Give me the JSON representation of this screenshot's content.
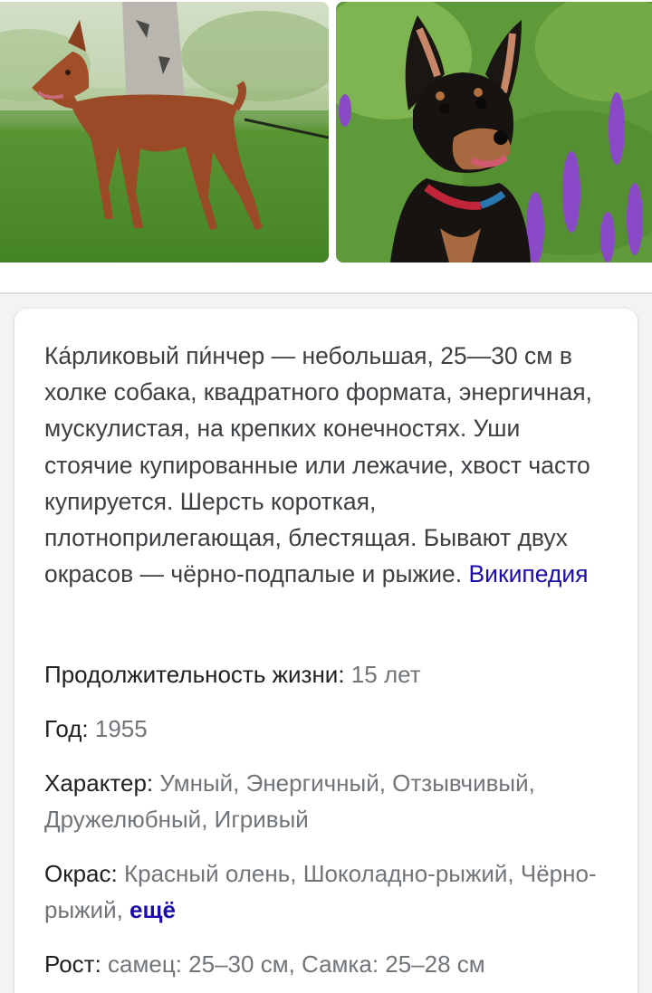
{
  "gallery": {
    "images": [
      {
        "subject": "red miniature pinscher standing on grass on a leash"
      },
      {
        "subject": "black and tan miniature pinscher among purple flowers"
      }
    ]
  },
  "card": {
    "description": "Ка́рликовый пи́нчер — небольшая, 25—30 см в холке собака, квадратного формата, энергичная, мускулистая, на крепких конечностях. Уши стоячие купированные или лежачие, хвост часто купируется. Шерсть короткая, плотноприлегающая, блестящая. Бывают двух окрасов — чёрно-подпалые и рыжие.",
    "source_link": "Википедия",
    "facts": {
      "life": {
        "label": "Продолжительность жизни:",
        "value": "15 лет"
      },
      "year": {
        "label": "Год:",
        "value": "1955"
      },
      "character": {
        "label": "Характер:",
        "value": "Умный, Энергичный, Отзывчивый, Дружелюбный, Игривый"
      },
      "color": {
        "label": "Окрас:",
        "value": "Красный олень, Шоколадно-рыжий, Чёрно-рыжий,",
        "more": "ещё"
      },
      "height": {
        "label": "Рост:",
        "value": "самец: 25–30 см, Самка: 25–28 см"
      }
    }
  },
  "colors": {
    "link": "#1a0dab",
    "label_text": "#202124",
    "value_text": "#70757a",
    "body_text": "#3c4043"
  }
}
